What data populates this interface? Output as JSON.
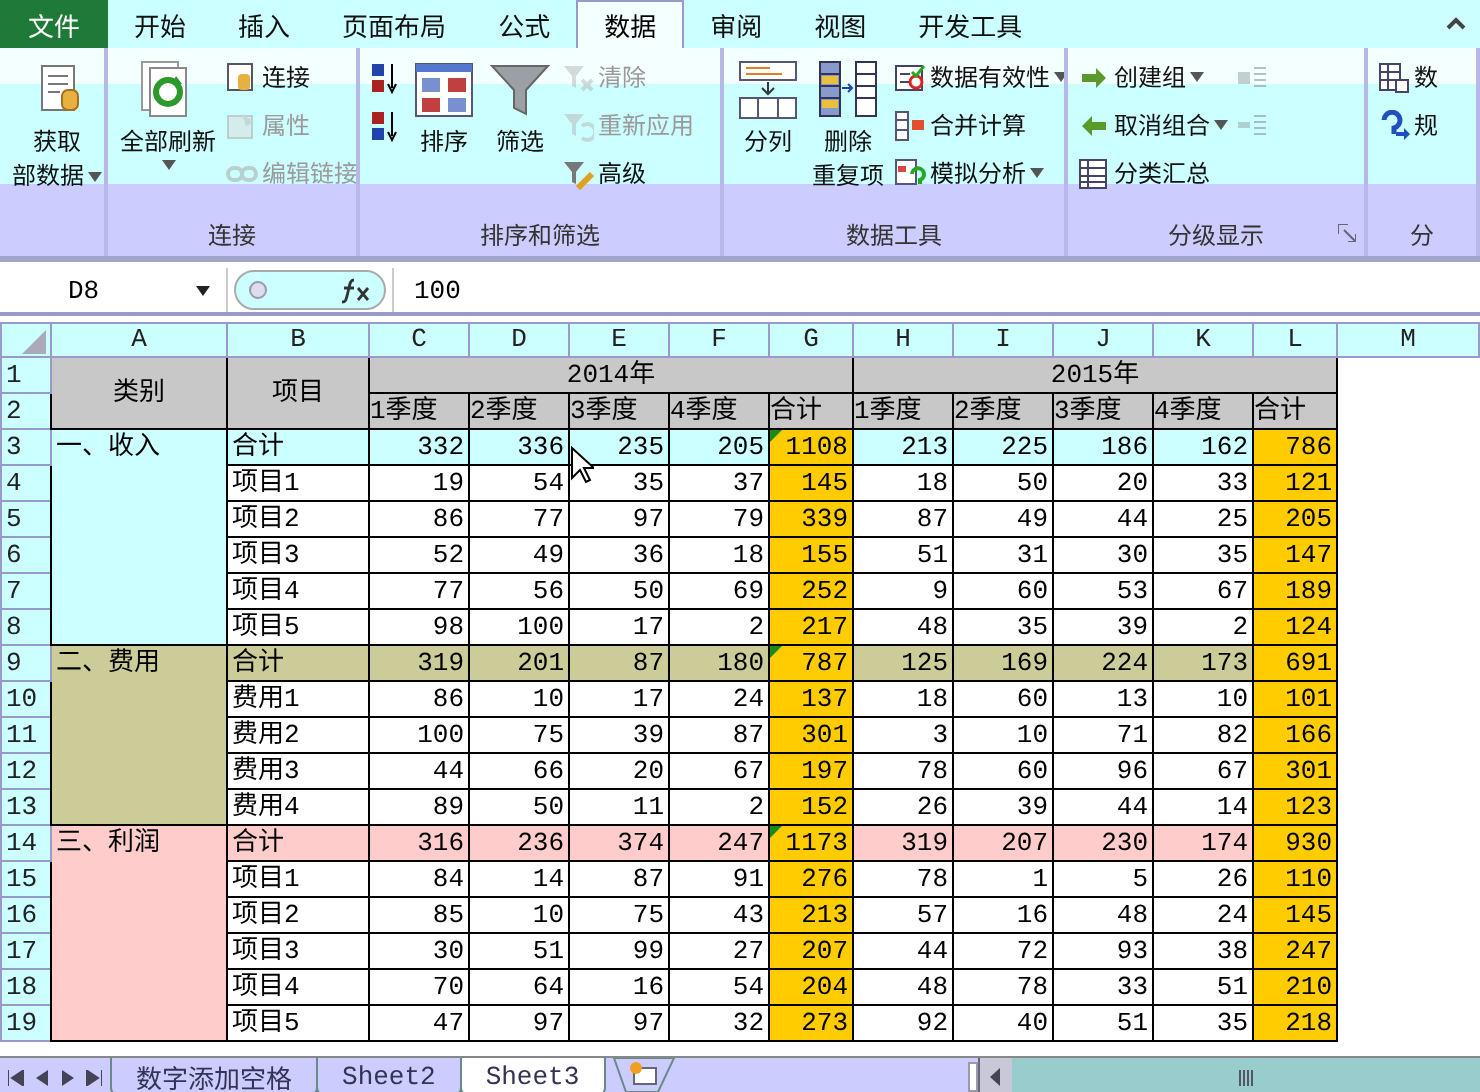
{
  "ribbon_tabs": [
    {
      "label": "文件",
      "kind": "file",
      "selected": false
    },
    {
      "label": "开始",
      "kind": "tab",
      "selected": false
    },
    {
      "label": "插入",
      "kind": "tab",
      "selected": false
    },
    {
      "label": "页面布局",
      "kind": "tab",
      "selected": false
    },
    {
      "label": "公式",
      "kind": "tab",
      "selected": false
    },
    {
      "label": "数据",
      "kind": "tab",
      "selected": true
    },
    {
      "label": "审阅",
      "kind": "tab",
      "selected": false
    },
    {
      "label": "视图",
      "kind": "tab",
      "selected": false
    },
    {
      "label": "开发工具",
      "kind": "tab",
      "selected": false
    }
  ],
  "ribbon_groups": [
    {
      "items": [
        {
          "kind": "large",
          "lines": [
            "获取",
            "部数据"
          ],
          "dropdown": true,
          "disabled": false
        }
      ]
    },
    {
      "label": "连接",
      "items": [
        {
          "kind": "large",
          "lines": [
            "全部刷新"
          ],
          "dropdown": true,
          "disabled": false
        },
        {
          "kind": "stack",
          "items": [
            {
              "label": "连接",
              "dropdown": false,
              "disabled": false
            },
            {
              "label": "属性",
              "dropdown": false,
              "disabled": true
            },
            {
              "label": "编辑链接",
              "dropdown": false,
              "disabled": true
            }
          ]
        }
      ]
    },
    {
      "label": "排序和筛选",
      "items": [
        {
          "kind": "stack",
          "items": [
            {
              "dropdown": false,
              "disabled": false
            },
            {
              "dropdown": false,
              "disabled": false
            }
          ]
        },
        {
          "kind": "large",
          "lines": [
            "排序"
          ],
          "dropdown": false,
          "disabled": false
        },
        {
          "kind": "large",
          "lines": [
            "筛选"
          ],
          "dropdown": false,
          "disabled": false
        },
        {
          "kind": "stack",
          "items": [
            {
              "label": "清除",
              "dropdown": false,
              "disabled": true
            },
            {
              "label": "重新应用",
              "dropdown": false,
              "disabled": true
            },
            {
              "label": "高级",
              "dropdown": false,
              "disabled": false
            }
          ]
        }
      ]
    },
    {
      "label": "数据工具",
      "items": [
        {
          "kind": "large",
          "lines": [
            "分列"
          ],
          "dropdown": false,
          "disabled": false
        },
        {
          "kind": "large",
          "lines": [
            "删除",
            "重复项"
          ],
          "dropdown": false,
          "disabled": false
        },
        {
          "kind": "stack",
          "items": [
            {
              "label": "数据有效性",
              "dropdown": true,
              "disabled": false
            },
            {
              "label": "合并计算",
              "dropdown": false,
              "disabled": false
            },
            {
              "label": "模拟分析",
              "dropdown": true,
              "disabled": false
            }
          ]
        }
      ]
    },
    {
      "label": "分级显示",
      "launcher": true,
      "items": [
        {
          "kind": "stack",
          "items": [
            {
              "label": "创建组",
              "dropdown": true,
              "disabled": false
            },
            {
              "label": "取消组合",
              "dropdown": true,
              "disabled": false
            },
            {
              "label": "分类汇总",
              "dropdown": false,
              "disabled": false
            }
          ]
        },
        {
          "kind": "stack",
          "items": [
            {
              "dropdown": false,
              "disabled": true
            },
            {
              "dropdown": false,
              "disabled": true
            }
          ]
        }
      ]
    },
    {
      "label": "分",
      "items": [
        {
          "kind": "stack",
          "items": [
            {
              "label": "数",
              "dropdown": false,
              "disabled": false
            },
            {
              "label": "规",
              "dropdown": false,
              "disabled": false
            }
          ]
        }
      ]
    }
  ],
  "name_box": "D8",
  "formula": "100",
  "columns": [
    "A",
    "B",
    "C",
    "D",
    "E",
    "F",
    "G",
    "H",
    "I",
    "J",
    "K",
    "L",
    "M"
  ],
  "header": {
    "row_numbers": [
      "1",
      "2"
    ],
    "category": "类别",
    "item": "项目",
    "years": [
      {
        "label": "2014年",
        "columns": [
          {
            "label": "1季度",
            "kind": "quarter"
          },
          {
            "label": "2季度",
            "kind": "quarter"
          },
          {
            "label": "3季度",
            "kind": "quarter"
          },
          {
            "label": "4季度",
            "kind": "quarter"
          },
          {
            "label": "合计",
            "kind": "total"
          }
        ]
      },
      {
        "label": "2015年",
        "columns": [
          {
            "label": "1季度",
            "kind": "quarter"
          },
          {
            "label": "2季度",
            "kind": "quarter"
          },
          {
            "label": "3季度",
            "kind": "quarter"
          },
          {
            "label": "4季度",
            "kind": "quarter"
          },
          {
            "label": "合计",
            "kind": "total"
          }
        ]
      }
    ]
  },
  "sections": [
    {
      "category": "一、收入",
      "color": "#ccffff",
      "rows": [
        {
          "number": "3",
          "kind": "total",
          "item": "合计",
          "flagged": true,
          "values": [
            [
              "332",
              "336",
              "235",
              "205",
              "1108"
            ],
            [
              "213",
              "225",
              "186",
              "162",
              "786"
            ]
          ]
        },
        {
          "number": "4",
          "kind": "item",
          "item": "项目1",
          "flagged": false,
          "values": [
            [
              "19",
              "54",
              "35",
              "37",
              "145"
            ],
            [
              "18",
              "50",
              "20",
              "33",
              "121"
            ]
          ]
        },
        {
          "number": "5",
          "kind": "item",
          "item": "项目2",
          "flagged": false,
          "values": [
            [
              "86",
              "77",
              "97",
              "79",
              "339"
            ],
            [
              "87",
              "49",
              "44",
              "25",
              "205"
            ]
          ]
        },
        {
          "number": "6",
          "kind": "item",
          "item": "项目3",
          "flagged": false,
          "values": [
            [
              "52",
              "49",
              "36",
              "18",
              "155"
            ],
            [
              "51",
              "31",
              "30",
              "35",
              "147"
            ]
          ]
        },
        {
          "number": "7",
          "kind": "item",
          "item": "项目4",
          "flagged": false,
          "values": [
            [
              "77",
              "56",
              "50",
              "69",
              "252"
            ],
            [
              "9",
              "60",
              "53",
              "67",
              "189"
            ]
          ]
        },
        {
          "number": "8",
          "kind": "item",
          "item": "项目5",
          "flagged": false,
          "values": [
            [
              "98",
              "100",
              "17",
              "2",
              "217"
            ],
            [
              "48",
              "35",
              "39",
              "2",
              "124"
            ]
          ]
        }
      ]
    },
    {
      "category": "二、费用",
      "color": "#cccc99",
      "rows": [
        {
          "number": "9",
          "kind": "total",
          "item": "合计",
          "flagged": true,
          "values": [
            [
              "319",
              "201",
              "87",
              "180",
              "787"
            ],
            [
              "125",
              "169",
              "224",
              "173",
              "691"
            ]
          ]
        },
        {
          "number": "10",
          "kind": "item",
          "item": "费用1",
          "flagged": false,
          "values": [
            [
              "86",
              "10",
              "17",
              "24",
              "137"
            ],
            [
              "18",
              "60",
              "13",
              "10",
              "101"
            ]
          ]
        },
        {
          "number": "11",
          "kind": "item",
          "item": "费用2",
          "flagged": false,
          "values": [
            [
              "100",
              "75",
              "39",
              "87",
              "301"
            ],
            [
              "3",
              "10",
              "71",
              "82",
              "166"
            ]
          ]
        },
        {
          "number": "12",
          "kind": "item",
          "item": "费用3",
          "flagged": false,
          "values": [
            [
              "44",
              "66",
              "20",
              "67",
              "197"
            ],
            [
              "78",
              "60",
              "96",
              "67",
              "301"
            ]
          ]
        },
        {
          "number": "13",
          "kind": "item",
          "item": "费用4",
          "flagged": false,
          "values": [
            [
              "89",
              "50",
              "11",
              "2",
              "152"
            ],
            [
              "26",
              "39",
              "44",
              "14",
              "123"
            ]
          ]
        }
      ]
    },
    {
      "category": "三、利润",
      "color": "#ffcccc",
      "rows": [
        {
          "number": "14",
          "kind": "total",
          "item": "合计",
          "flagged": true,
          "values": [
            [
              "316",
              "236",
              "374",
              "247",
              "1173"
            ],
            [
              "319",
              "207",
              "230",
              "174",
              "930"
            ]
          ]
        },
        {
          "number": "15",
          "kind": "item",
          "item": "项目1",
          "flagged": false,
          "values": [
            [
              "84",
              "14",
              "87",
              "91",
              "276"
            ],
            [
              "78",
              "1",
              "5",
              "26",
              "110"
            ]
          ]
        },
        {
          "number": "16",
          "kind": "item",
          "item": "项目2",
          "flagged": false,
          "values": [
            [
              "85",
              "10",
              "75",
              "43",
              "213"
            ],
            [
              "57",
              "16",
              "48",
              "24",
              "145"
            ]
          ]
        },
        {
          "number": "17",
          "kind": "item",
          "item": "项目3",
          "flagged": false,
          "values": [
            [
              "30",
              "51",
              "99",
              "27",
              "207"
            ],
            [
              "44",
              "72",
              "93",
              "38",
              "247"
            ]
          ]
        },
        {
          "number": "18",
          "kind": "item",
          "item": "项目4",
          "flagged": false,
          "values": [
            [
              "70",
              "64",
              "16",
              "54",
              "204"
            ],
            [
              "48",
              "78",
              "33",
              "51",
              "210"
            ]
          ]
        },
        {
          "number": "19",
          "kind": "item",
          "item": "项目5",
          "flagged": false,
          "values": [
            [
              "47",
              "97",
              "97",
              "32",
              "273"
            ],
            [
              "92",
              "40",
              "51",
              "35",
              "218"
            ]
          ]
        }
      ]
    }
  ],
  "sheet_tabs": [
    {
      "label": "数字添加空格",
      "selected": false
    },
    {
      "label": "Sheet2",
      "selected": false
    },
    {
      "label": "Sheet3",
      "selected": true
    }
  ]
}
